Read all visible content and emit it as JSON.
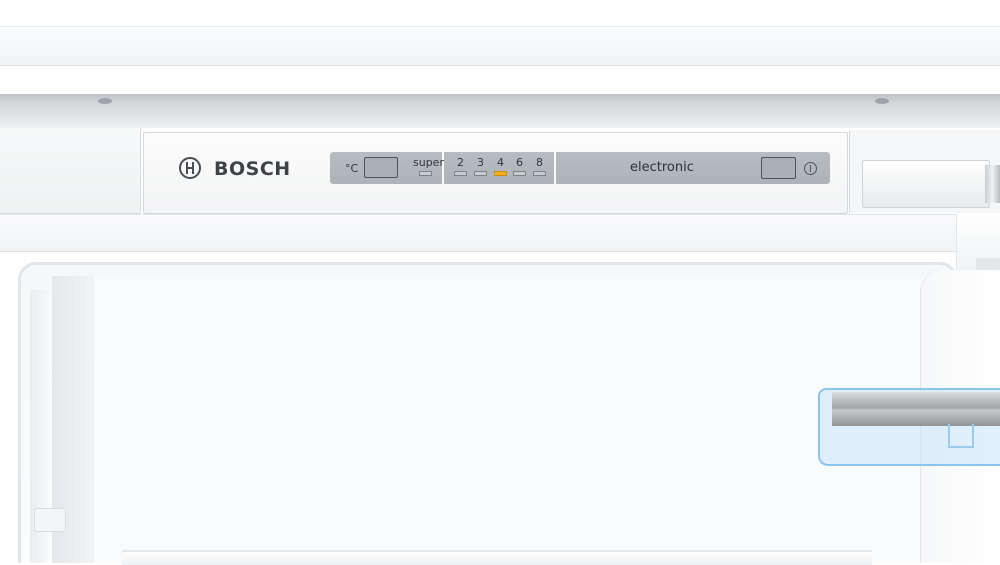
{
  "brand": {
    "name": "BOSCH",
    "logo_icon": "bosch-armature-icon"
  },
  "control_panel": {
    "unit_label": "°C",
    "super_label": "super",
    "temperature_levels": [
      "2",
      "3",
      "4",
      "6",
      "8"
    ],
    "active_level": "4",
    "mode_label": "electronic",
    "indicator_on_color": "#f2b01e"
  },
  "icons": [
    "power-icon",
    "bosch-armature-icon"
  ]
}
